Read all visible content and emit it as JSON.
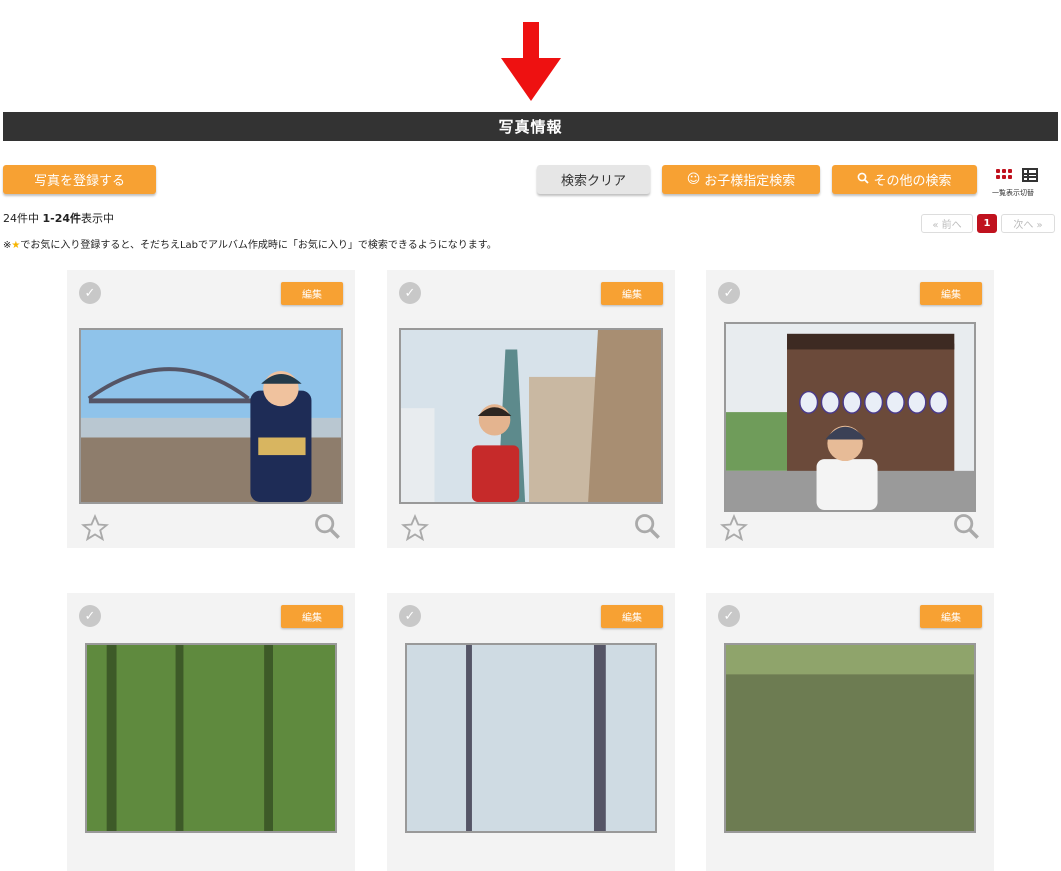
{
  "title": "写真情報",
  "buttons": {
    "register": "写真を登録する",
    "clear": "検索クリア",
    "child_search": "お子様指定検索",
    "other_search": "その他の検索"
  },
  "view_toggle_label": "一覧表示切替",
  "result": {
    "total": "24件中",
    "range": "1-24件",
    "suffix": "表示中"
  },
  "note": {
    "prefix": "※",
    "star": "★",
    "text": "でお気に入り登録すると、そだちえLabでアルバム作成時に「お気に入り」で検索できるようになります。"
  },
  "pagination": {
    "prev": "« 前へ",
    "current": "1",
    "next": "次へ »"
  },
  "card_edit_label": "編集",
  "icons": [
    "down-arrow-icon",
    "check-icon",
    "star-outline-icon",
    "zoom-icon",
    "grid-view-icon",
    "list-view-icon",
    "smile-icon",
    "search-icon"
  ],
  "colors": {
    "accent": "#f7a133",
    "header": "#333333",
    "pager_active": "#c0121e",
    "arrow": "#ee1111"
  }
}
